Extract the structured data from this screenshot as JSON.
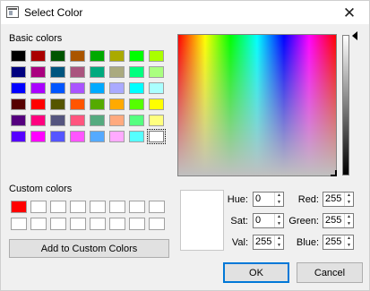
{
  "window": {
    "title": "Select Color",
    "close_icon": "close-icon"
  },
  "basic_colors": {
    "label": "Basic colors",
    "rows": [
      [
        "#000000",
        "#aa0000",
        "#005500",
        "#aa5500",
        "#00aa00",
        "#aaaa00",
        "#00ff00",
        "#aaff00"
      ],
      [
        "#00007f",
        "#aa007f",
        "#00557f",
        "#aa557f",
        "#00aa7f",
        "#aaaa7f",
        "#00ff7f",
        "#aaff7f"
      ],
      [
        "#0000ff",
        "#aa00ff",
        "#0055ff",
        "#aa55ff",
        "#00aaff",
        "#aaaaff",
        "#00ffff",
        "#aaffff"
      ],
      [
        "#550000",
        "#ff0000",
        "#555500",
        "#ff5500",
        "#55aa00",
        "#ffaa00",
        "#55ff00",
        "#ffff00"
      ],
      [
        "#55007f",
        "#ff007f",
        "#55557f",
        "#ff557f",
        "#55aa7f",
        "#ffaa7f",
        "#55ff7f",
        "#ffff7f"
      ],
      [
        "#5500ff",
        "#ff00ff",
        "#5555ff",
        "#ff55ff",
        "#55aaff",
        "#ffaaff",
        "#55ffff",
        "#ffffff"
      ]
    ],
    "selected": "#ffffff"
  },
  "custom_colors": {
    "label": "Custom colors",
    "slots": [
      "#ff0000",
      "#ffffff",
      "#ffffff",
      "#ffffff",
      "#ffffff",
      "#ffffff",
      "#ffffff",
      "#ffffff",
      "#ffffff",
      "#ffffff",
      "#ffffff",
      "#ffffff",
      "#ffffff",
      "#ffffff",
      "#ffffff",
      "#ffffff"
    ]
  },
  "add_button": {
    "label": "Add to Custom Colors"
  },
  "fields": {
    "hue": {
      "label": "Hue:",
      "value": "0"
    },
    "sat": {
      "label": "Sat:",
      "value": "0"
    },
    "val": {
      "label": "Val:",
      "value": "255"
    },
    "red": {
      "label": "Red:",
      "value": "255"
    },
    "green": {
      "label": "Green:",
      "value": "255"
    },
    "blue": {
      "label": "Blue:",
      "value": "255"
    }
  },
  "preview_color": "#ffffff",
  "ok_button": {
    "label": "OK"
  },
  "cancel_button": {
    "label": "Cancel"
  }
}
